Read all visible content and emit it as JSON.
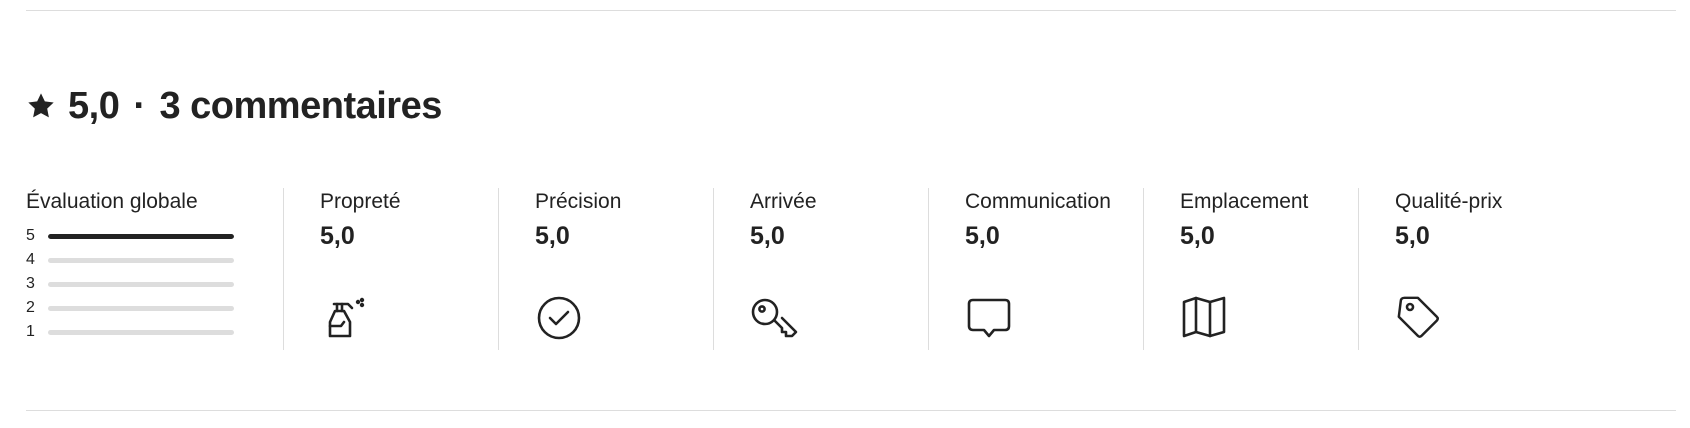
{
  "reviews": {
    "heading": {
      "rating": "5,0",
      "separator": "·",
      "count_text": "3 commentaires"
    },
    "overall": {
      "label": "Évaluation globale",
      "distribution": [
        {
          "stars": "5",
          "fraction": 1.0
        },
        {
          "stars": "4",
          "fraction": 0.0
        },
        {
          "stars": "3",
          "fraction": 0.0
        },
        {
          "stars": "2",
          "fraction": 0.0
        },
        {
          "stars": "1",
          "fraction": 0.0
        }
      ]
    },
    "categories": [
      {
        "label": "Propreté",
        "value": "5,0",
        "icon": "spray-bottle-icon"
      },
      {
        "label": "Précision",
        "value": "5,0",
        "icon": "check-circle-icon"
      },
      {
        "label": "Arrivée",
        "value": "5,0",
        "icon": "key-icon"
      },
      {
        "label": "Communication",
        "value": "5,0",
        "icon": "chat-bubble-icon"
      },
      {
        "label": "Emplacement",
        "value": "5,0",
        "icon": "map-icon"
      },
      {
        "label": "Qualité-prix",
        "value": "5,0",
        "icon": "price-tag-icon"
      }
    ],
    "colors": {
      "text": "#222222",
      "bar_track": "#dddddd",
      "bar_fill": "#222222",
      "divider": "#dddddd"
    }
  }
}
